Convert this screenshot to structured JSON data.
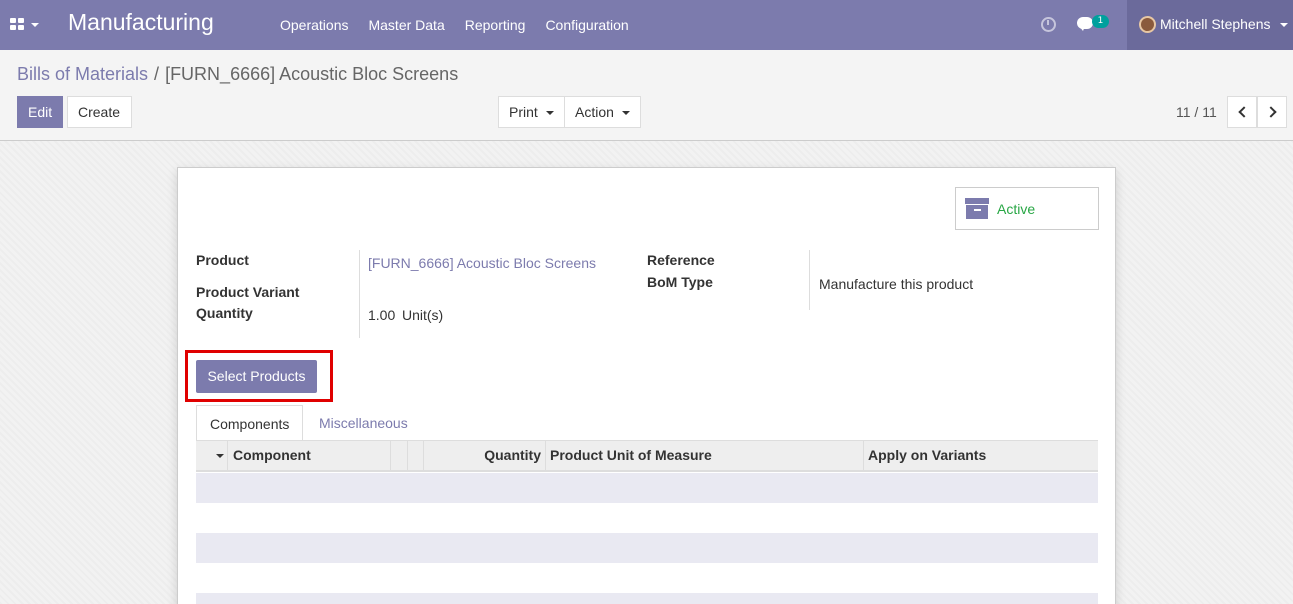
{
  "app": {
    "name": "Manufacturing"
  },
  "menu": [
    {
      "label": "Operations"
    },
    {
      "label": "Master Data"
    },
    {
      "label": "Reporting"
    },
    {
      "label": "Configuration"
    }
  ],
  "systray": {
    "activity_icon": "clock-icon",
    "chat_icon": "chat-icon",
    "message_count": "1"
  },
  "user": {
    "name": "Mitchell Stephens"
  },
  "breadcrumb": {
    "parent": "Bills of Materials",
    "separator": "/",
    "current": "[FURN_6666] Acoustic Bloc Screens"
  },
  "toolbar": {
    "edit_label": "Edit",
    "create_label": "Create",
    "print_label": "Print",
    "action_label": "Action"
  },
  "pager": {
    "value": "11 / 11"
  },
  "status": {
    "active_label": "Active",
    "active_color": "#28a745"
  },
  "fields": {
    "product_label": "Product",
    "product_value": "[FURN_6666] Acoustic Bloc Screens",
    "variant_label": "Product Variant",
    "quantity_label": "Quantity",
    "quantity_value": "1.00",
    "quantity_uom": "Unit(s)",
    "reference_label": "Reference",
    "bom_type_label": "BoM Type",
    "bom_type_value": "Manufacture this product"
  },
  "select_products_label": "Select Products",
  "tabs": [
    {
      "label": "Components",
      "active": true
    },
    {
      "label": "Miscellaneous",
      "active": false
    }
  ],
  "table": {
    "columns": [
      "Component",
      "Quantity",
      "Product Unit of Measure",
      "Apply on Variants"
    ],
    "rows": []
  },
  "colors": {
    "brand": "#7c7bad",
    "highlight": "#e00000",
    "active": "#28a745"
  }
}
